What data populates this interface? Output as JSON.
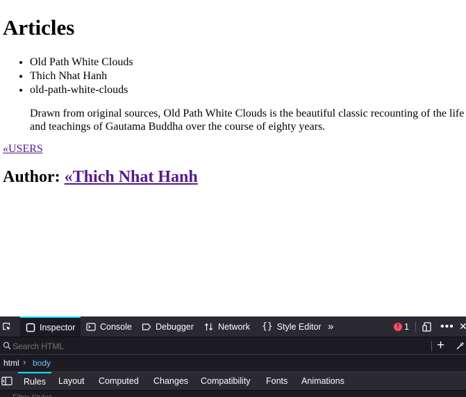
{
  "page": {
    "heading": "Articles",
    "list_items": [
      "Old Path White Clouds",
      "Thich Nhat Hanh",
      "old-path-white-clouds"
    ],
    "description": "Drawn from original sources, Old Path White Clouds is the beautiful classic recounting of the life and teachings of Gautama Buddha over the course of eighty years.",
    "users_link": "«USERS",
    "author_label": "Author:",
    "author_link": "«Thich Nhat Hanh"
  },
  "devtools": {
    "tools": [
      "Inspector",
      "Console",
      "Debugger",
      "Network",
      "Style Editor"
    ],
    "active_tool": "Inspector",
    "error_count": "1",
    "search_placeholder": "Search HTML",
    "breadcrumbs": [
      "html",
      "body"
    ],
    "panel_tabs": [
      "Rules",
      "Layout",
      "Computed",
      "Changes",
      "Compatibility",
      "Fonts",
      "Animations"
    ],
    "active_panel_tab": "Rules",
    "filter_placeholder": "Filter Styles",
    "colors": {
      "accent": "#0ae0ff",
      "error": "#ff4f5e",
      "link_visited": "#551a8b",
      "crumb_active": "#75bfff"
    }
  }
}
